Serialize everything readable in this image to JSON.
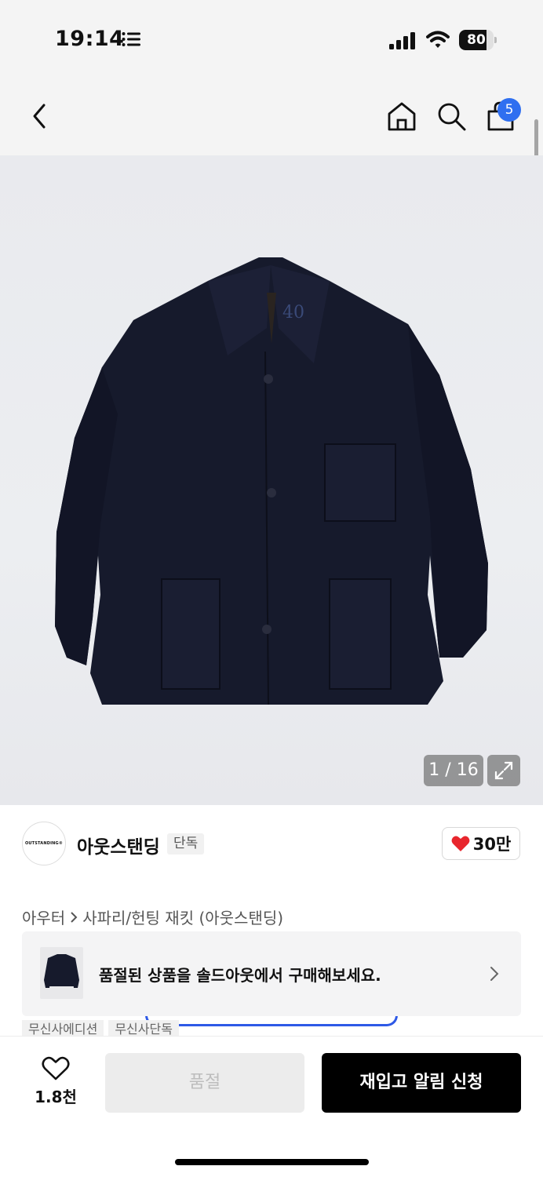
{
  "status_bar": {
    "time": "19:14",
    "battery": "80",
    "battery_level": 0.8
  },
  "nav": {
    "cart_count": "5"
  },
  "gallery": {
    "counter": "1 / 16"
  },
  "brand": {
    "logo_text": "OUTSTANDING®",
    "name": "아웃스탠딩",
    "tag": "단독",
    "likes": "30만"
  },
  "breadcrumb": {
    "parent": "아우터",
    "current": "사파리/헌팅 재킷 (아웃스탠딩)"
  },
  "soldout_banner": {
    "text": "품절된 상품을 솔드아웃에서 구매해보세요."
  },
  "peek_tags": [
    "무신사에디션",
    "무신사단독"
  ],
  "bottom_bar": {
    "wishlist_count": "1.8천",
    "soldout_label": "품절",
    "restock_label": "재입고 알림 신청"
  },
  "colors": {
    "accent_blue": "#2f6ff0",
    "heart_red": "#e8262d",
    "jacket_navy": "#161a2c"
  },
  "icons": [
    "list-icon",
    "signal-icon",
    "wifi-icon",
    "back-icon",
    "home-icon",
    "search-icon",
    "shopping-bag-icon",
    "expand-icon",
    "heart-icon",
    "chevron-right-icon"
  ]
}
